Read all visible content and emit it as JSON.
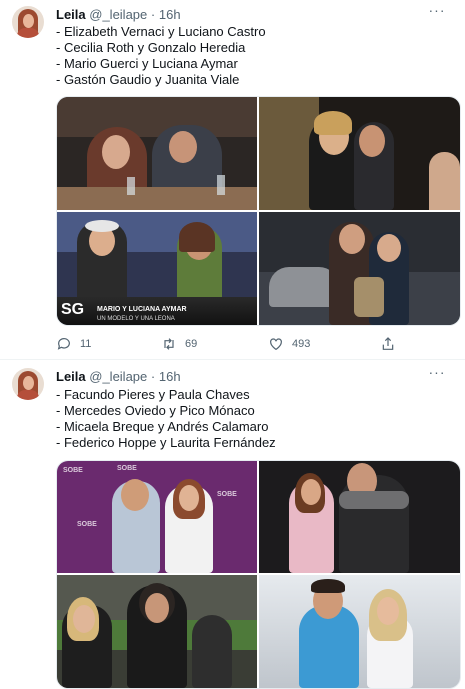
{
  "tweets": [
    {
      "author": {
        "name": "Leila",
        "handle": "@_leilape",
        "time": "16h"
      },
      "more_label": "···",
      "lines": [
        "- Elizabeth Vernaci y Luciano Castro",
        "- Cecilia Roth y Gonzalo Heredia",
        "- Mario Guerci y Luciana Aymar",
        "- Gastón Gaudio y Juanita Viale"
      ],
      "media_caption": {
        "logo": "SG",
        "line1": "MARIO Y LUCIANA AYMAR",
        "line2": "UN MODELO Y UNA LEONA"
      },
      "stats": {
        "replies": "11",
        "retweets": "69",
        "likes": "493"
      }
    },
    {
      "author": {
        "name": "Leila",
        "handle": "@_leilape",
        "time": "16h"
      },
      "more_label": "···",
      "lines": [
        "- Facundo Pieres y Paula Chaves",
        "- Mercedes Oviedo y Pico Mónaco",
        "- Micaela Breque y Andrés Calamaro",
        "- Federico Hoppe y Laurita Fernández"
      ],
      "media_watermark": "SOBE"
    }
  ],
  "colors": {
    "text": "#0f1419",
    "secondary": "#536471",
    "divider": "#eff3f4"
  },
  "icons": [
    "more-icon",
    "reply-icon",
    "retweet-icon",
    "like-icon",
    "share-icon"
  ]
}
